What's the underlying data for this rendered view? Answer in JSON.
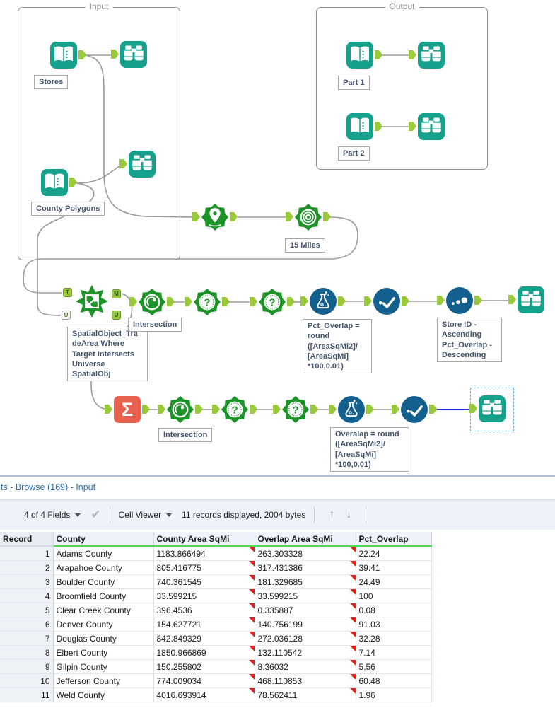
{
  "canvas": {
    "containers": {
      "input_label": "Input",
      "output_label": "Output"
    },
    "labels": {
      "stores": "Stores",
      "county_polygons": "County Polygons",
      "part1": "Part 1",
      "part2": "Part 2",
      "trade_area_radius": "15 Miles",
      "intersection_row1": "Intersection",
      "intersection_row2": "Intersection",
      "spatial_match_note": "SpatialObject_Tra\ndeArea Where\nTarget Intersects\nUniverse\nSpatialObj",
      "formula_row1_note": "Pct_Overlap =\nround\n([AreaSqMi2]/\n[AreaSqMi]\n*100,0.01)",
      "sort_note": "Store ID -\nAscending\nPct_Overlap -\nDescending",
      "formula_row2_note": "Overalap = round\n([AreaSqMi2]/\n[AreaSqMi]\n*100,0.01)"
    },
    "anchors": {
      "t": "T",
      "m": "M",
      "u_in": "U",
      "u_out": "U"
    }
  },
  "results_panel": {
    "tab_label": "ts - Browse (169) - Input",
    "toolbar": {
      "fields_dropdown": "4 of 4 Fields",
      "cell_viewer_dropdown": "Cell Viewer",
      "records_summary": "11 records displayed, 2004 bytes",
      "up_arrow": "↑",
      "down_arrow": "↓",
      "apply_check": "✔"
    },
    "table": {
      "columns": [
        "Record",
        "County",
        "County Area SqMi",
        "Overlap Area SqMi",
        "Pct_Overlap"
      ],
      "rows": [
        [
          "1",
          "Adams County",
          "1183.866494",
          "263.303328",
          "22.24"
        ],
        [
          "2",
          "Arapahoe County",
          "805.416775",
          "317.431386",
          "39.41"
        ],
        [
          "3",
          "Boulder County",
          "740.361545",
          "181.329685",
          "24.49"
        ],
        [
          "4",
          "Broomfield County",
          "33.599215",
          "33.599215",
          "100"
        ],
        [
          "5",
          "Clear Creek County",
          "396.4536",
          "0.335887",
          "0.08"
        ],
        [
          "6",
          "Denver County",
          "154.627721",
          "140.756199",
          "91.03"
        ],
        [
          "7",
          "Douglas County",
          "842.849329",
          "272.036128",
          "32.28"
        ],
        [
          "8",
          "Elbert County",
          "1850.966869",
          "132.110542",
          "7.14"
        ],
        [
          "9",
          "Gilpin County",
          "150.255802",
          "8.36032",
          "5.56"
        ],
        [
          "10",
          "Jefferson County",
          "774.009034",
          "468.110853",
          "60.48"
        ],
        [
          "11",
          "Weld County",
          "4016.693914",
          "78.562411",
          "1.96"
        ]
      ]
    }
  },
  "colors": {
    "teal": "#16A18C",
    "green": "#1D9427",
    "blue": "#13608F",
    "orange": "#E8614F",
    "anchor_green": "#9ACA3C",
    "selected_wire": "#2B2BDF",
    "red_flag": "#E02318",
    "link_blue": "#2F6FB0"
  }
}
